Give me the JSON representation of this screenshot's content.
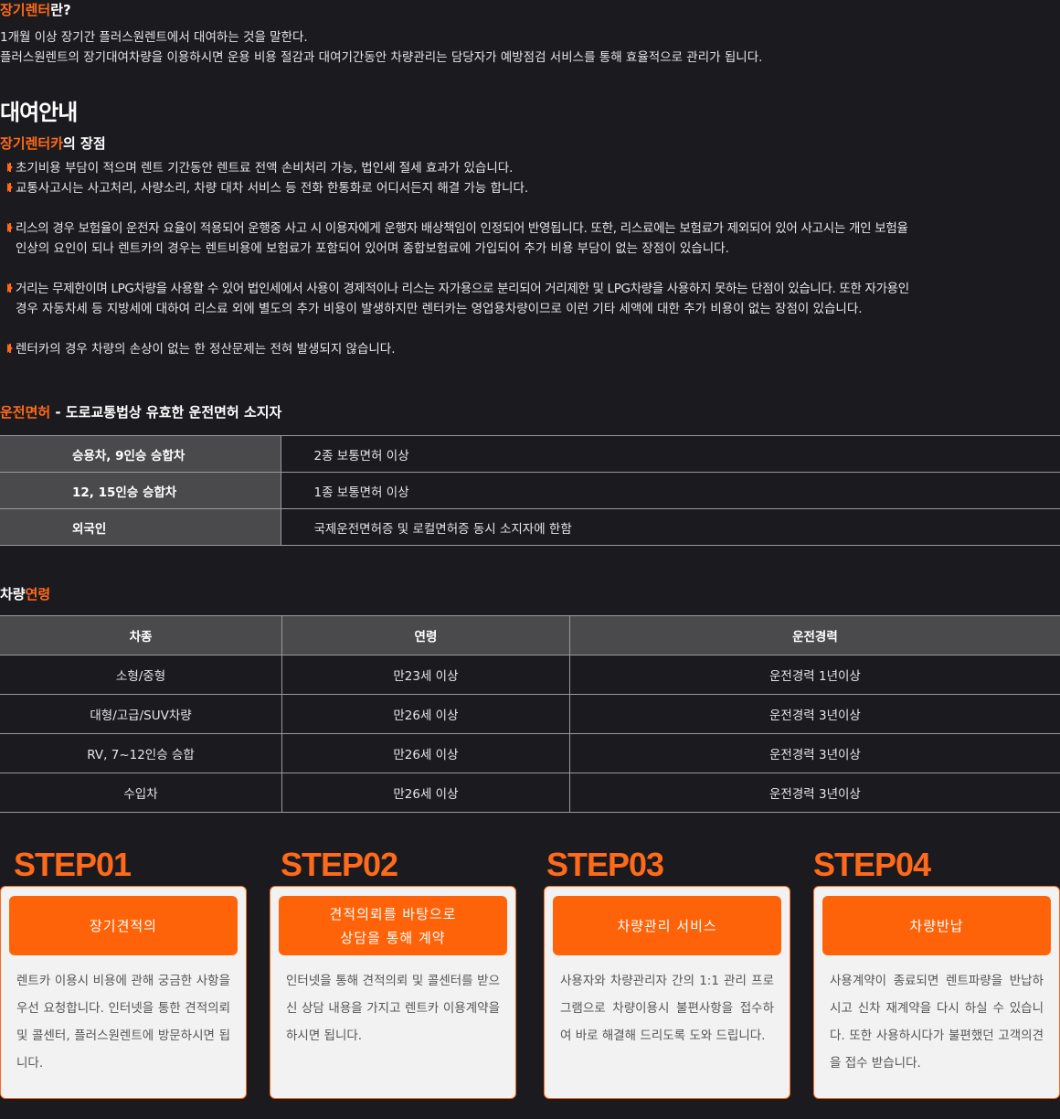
{
  "intro": {
    "title_accent": "장기렌터",
    "title_rest": "란?",
    "lines": [
      "1개월 이상 장기간 플러스원렌트에서 대여하는 것을 말한다.",
      "플러스원렌트의 장기대여차량을 이용하시면 운용 비용 절감과 대여기간동안 차량관리는 담당자가 예방점검 서비스를 통해 효율적으로 관리가 됩니다."
    ]
  },
  "guide": {
    "title": "대여안내",
    "advantage_accent": "장기렌터카",
    "advantage_rest": "의 장점",
    "bullets": [
      [
        "초기비용 부담이 적으며 렌트 기간동안 렌트료 전액 손비처리 가능, 법인세 절세 효과가 있습니다."
      ],
      [
        "교통사고시는 사고처리, 사량소리, 차량 대차 서비스 등 전화 한통화로 어디서든지 해결 가능 합니다."
      ],
      [
        "리스의 경우 보험율이 운전자 요율이 적용되어 운행중 사고 시 이용자에게 운행자 배상책임이 인정되어 반영됩니다. 또한, 리스료에는 보험료가 제외되어 있어 사고시는 개인 보험율",
        "인상의 요인이 되나 렌트카의 경우는 렌트비용에 보험료가 포함되어 있어며 종합보험료에 가입되어 추가 비용 부담이 없는 장점이 있습니다."
      ],
      [
        "거리는 무제한이며 LPG차량을 사용할 수 있어 법인세에서 사용이 경제적이나 리스는 자가용으로 분리되어 거리제한 및 LPG차량을 사용하지 못하는 단점이 있습니다. 또한 자가용인",
        "경우 자동차세 등 지방세에 대하여 리스료 외에 별도의 추가 비용이 발생하지만 렌터카는 영업용차량이므로 이런 기타 세액에 대한 추가 비용이 없는 장점이 있습니다."
      ],
      [
        "렌터카의 경우 차량의 손상이 없는 한 정산문제는 전혀 발생되지 않습니다."
      ]
    ]
  },
  "license": {
    "title_accent": "운전면허",
    "title_rest": " - 도로교통법상 유효한 운전면허 소지자",
    "rows": [
      {
        "type": "승용차, 9인승 승합차",
        "req": "2종 보통면허 이상"
      },
      {
        "type": "12, 15인승 승합차",
        "req": "1종 보통면허 이상"
      },
      {
        "type": "외국인",
        "req": "국제운전면허증 및 로컬면허증 동시 소지자에 한함"
      }
    ]
  },
  "age": {
    "title_plain": "차량",
    "title_accent": "연령",
    "headers": [
      "차종",
      "연령",
      "운전경력"
    ],
    "rows": [
      [
        "소형/중형",
        "만23세 이상",
        "운전경력 1년이상"
      ],
      [
        "대형/고급/SUV차량",
        "만26세 이상",
        "운전경력 3년이상"
      ],
      [
        "RV, 7~12인승 승합",
        "만26세 이상",
        "운전경력 3년이상"
      ],
      [
        "수입차",
        "만26세 이상",
        "운전경력 3년이상"
      ]
    ]
  },
  "steps": [
    {
      "label": "STEP01",
      "button": [
        "장기견적의"
      ],
      "desc": "렌트카 이용시 비용에 관해 궁금한 사항을 우선 요청합니다. 인터넷을 통한 견적의뢰 및 콜센터, 플러스원렌트에 방문하시면 됩니다."
    },
    {
      "label": "STEP02",
      "button": [
        "견적의뢰를 바탕으로",
        "상담을 통해 계약"
      ],
      "desc": "인터넷을 통해 견적의뢰 및 콜센터를 받으신 상담 내용을 가지고 렌트카 이용계약을 하시면 됩니다."
    },
    {
      "label": "STEP03",
      "button": [
        "차량관리 서비스"
      ],
      "desc": "사용자와 차량관리자 간의 1:1 관리 프로그램으로 차량이용시 불편사항을 접수하여 바로 해결해 드리도록 도와 드립니다."
    },
    {
      "label": "STEP04",
      "button": [
        "차량반납"
      ],
      "desc": "사용계약이 종료되면 렌트파량을 반납하시고 신차 재계약을 다시 하실 수 있습니다. 또한 사용하시다가 불편했던 고객의견을 접수 받습니다."
    }
  ]
}
